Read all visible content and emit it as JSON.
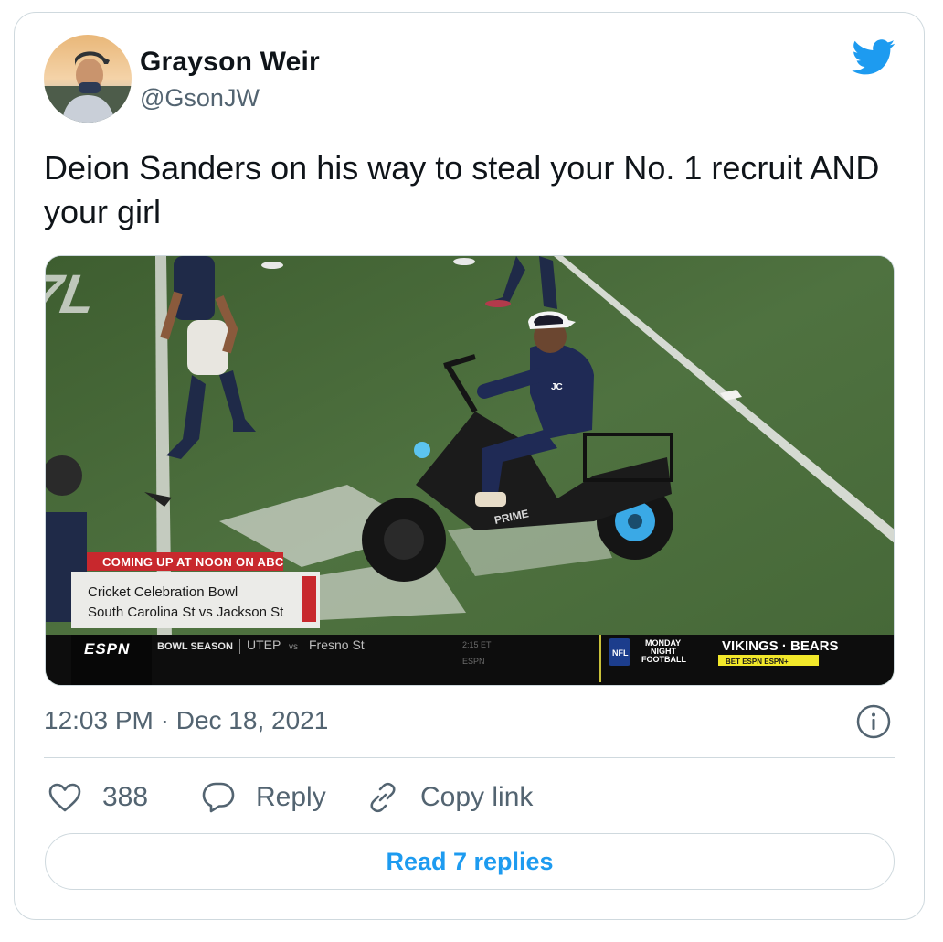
{
  "author": {
    "name": "Grayson Weir",
    "handle": "@GsonJW"
  },
  "tweet": {
    "text": "Deion Sanders on his way to steal your No. 1 recruit AND your girl",
    "timestamp": "12:03 PM · Dec 18, 2021"
  },
  "media": {
    "banner_title": "COMING UP AT NOON ON ABC",
    "banner_line1": "Cricket Celebration Bowl",
    "banner_line2": "South Carolina St vs Jackson St",
    "ticker_network": "ESPN",
    "ticker_section": "BOWL SEASON",
    "ticker_team1": "UTEP",
    "ticker_vs": "vs",
    "ticker_team2": "Fresno St",
    "ticker_time": "2:15 ET",
    "ticker_time_network": "ESPN",
    "mnf_line1": "MONDAY",
    "mnf_line2": "NIGHT",
    "mnf_line3": "FOOTBALL",
    "mnf_matchup": "VIKINGS · BEARS",
    "mnf_sub": "BET ESPN ESPN+",
    "bike_brand": "PRIME",
    "colors": {
      "field": "#4a6b38",
      "banner_red": "#c8282d",
      "ticker_black": "#0d0d0d",
      "matchup_yellow": "#f2e82a"
    }
  },
  "actions": {
    "like_count": "388",
    "reply_label": "Reply",
    "copy_label": "Copy link"
  },
  "read_replies": "Read 7 replies",
  "colors": {
    "accent": "#1d9bf0",
    "secondary_text": "#536471",
    "border": "#cfd9de"
  },
  "icons": [
    "twitter-bird-icon",
    "info-icon",
    "heart-icon",
    "reply-bubble-icon",
    "link-icon"
  ]
}
